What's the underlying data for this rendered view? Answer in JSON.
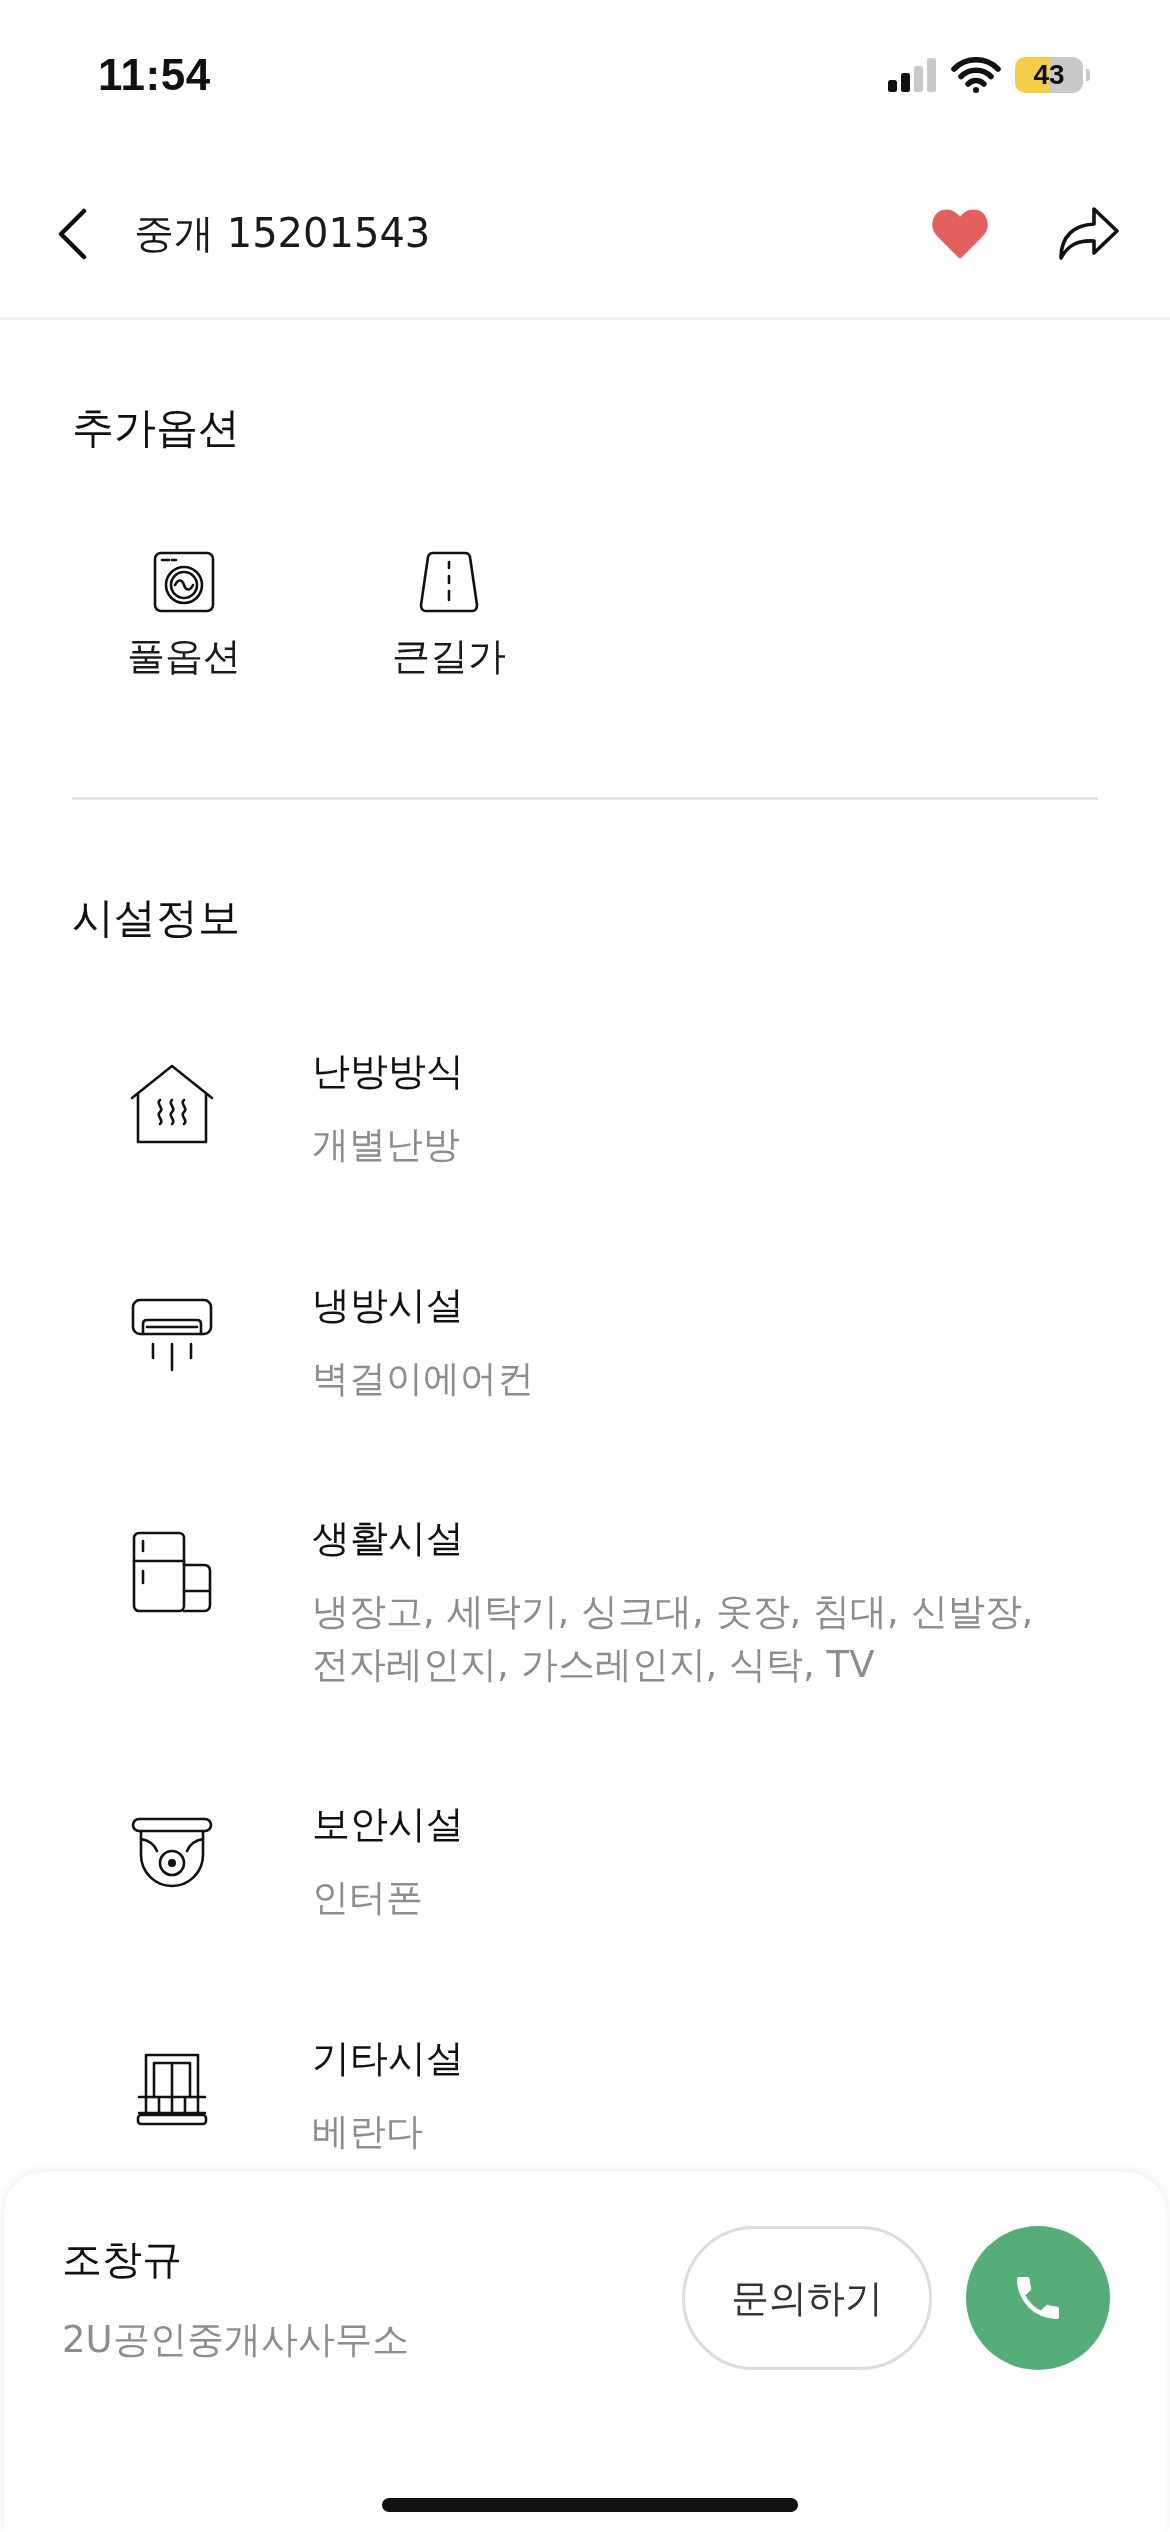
{
  "status_bar": {
    "time": "11:54",
    "battery": "43"
  },
  "header": {
    "title": "중개 15201543",
    "favorited": true
  },
  "options": {
    "title": "추가옵션",
    "items": [
      {
        "kind": "washer",
        "label": "풀옵션"
      },
      {
        "kind": "road",
        "label": "큰길가"
      }
    ]
  },
  "facilities": {
    "title": "시설정보",
    "items": [
      {
        "kind": "heating",
        "title": "난방방식",
        "value": "개별난방"
      },
      {
        "kind": "aircon",
        "title": "냉방시설",
        "value": "벽걸이에어컨"
      },
      {
        "kind": "appliance",
        "title": "생활시설",
        "value": "냉장고, 세탁기, 싱크대, 옷장, 침대, 신발장, 전자레인지, 가스레인지, 식탁, TV"
      },
      {
        "kind": "camera",
        "title": "보안시설",
        "value": "인터폰"
      },
      {
        "kind": "balcony",
        "title": "기타시설",
        "value": "베란다"
      }
    ]
  },
  "agent": {
    "name": "조창규",
    "office": "2U공인중개사사무소",
    "inquiry_button": "문의하기"
  }
}
